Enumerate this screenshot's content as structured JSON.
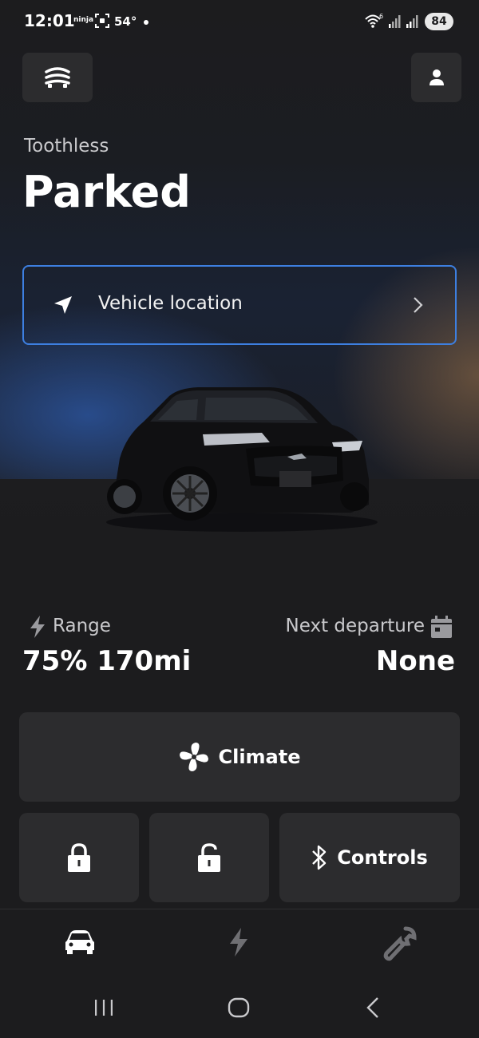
{
  "status_bar": {
    "time": "12:01",
    "notification": "ninja",
    "temperature": "54°",
    "wifi_label": "6",
    "battery": "84"
  },
  "header": {
    "menu_icon": "car-lines-icon",
    "profile_icon": "person-icon"
  },
  "vehicle": {
    "name": "Toothless",
    "status": "Parked"
  },
  "location_card": {
    "label": "Vehicle location",
    "icon": "navigation-arrow-icon"
  },
  "stats": {
    "range_label": "Range",
    "range_value": "75% 170mi",
    "departure_label": "Next departure",
    "departure_value": "None"
  },
  "actions": {
    "climate_label": "Climate",
    "controls_label": "Controls"
  },
  "bottom_nav": [
    "vehicle-icon",
    "charge-icon",
    "wrench-icon"
  ],
  "colors": {
    "background": "#1c1c1e",
    "tile": "#2c2c2e",
    "accent_border": "#3d7fe0",
    "secondary_text": "#c9c9cc"
  }
}
